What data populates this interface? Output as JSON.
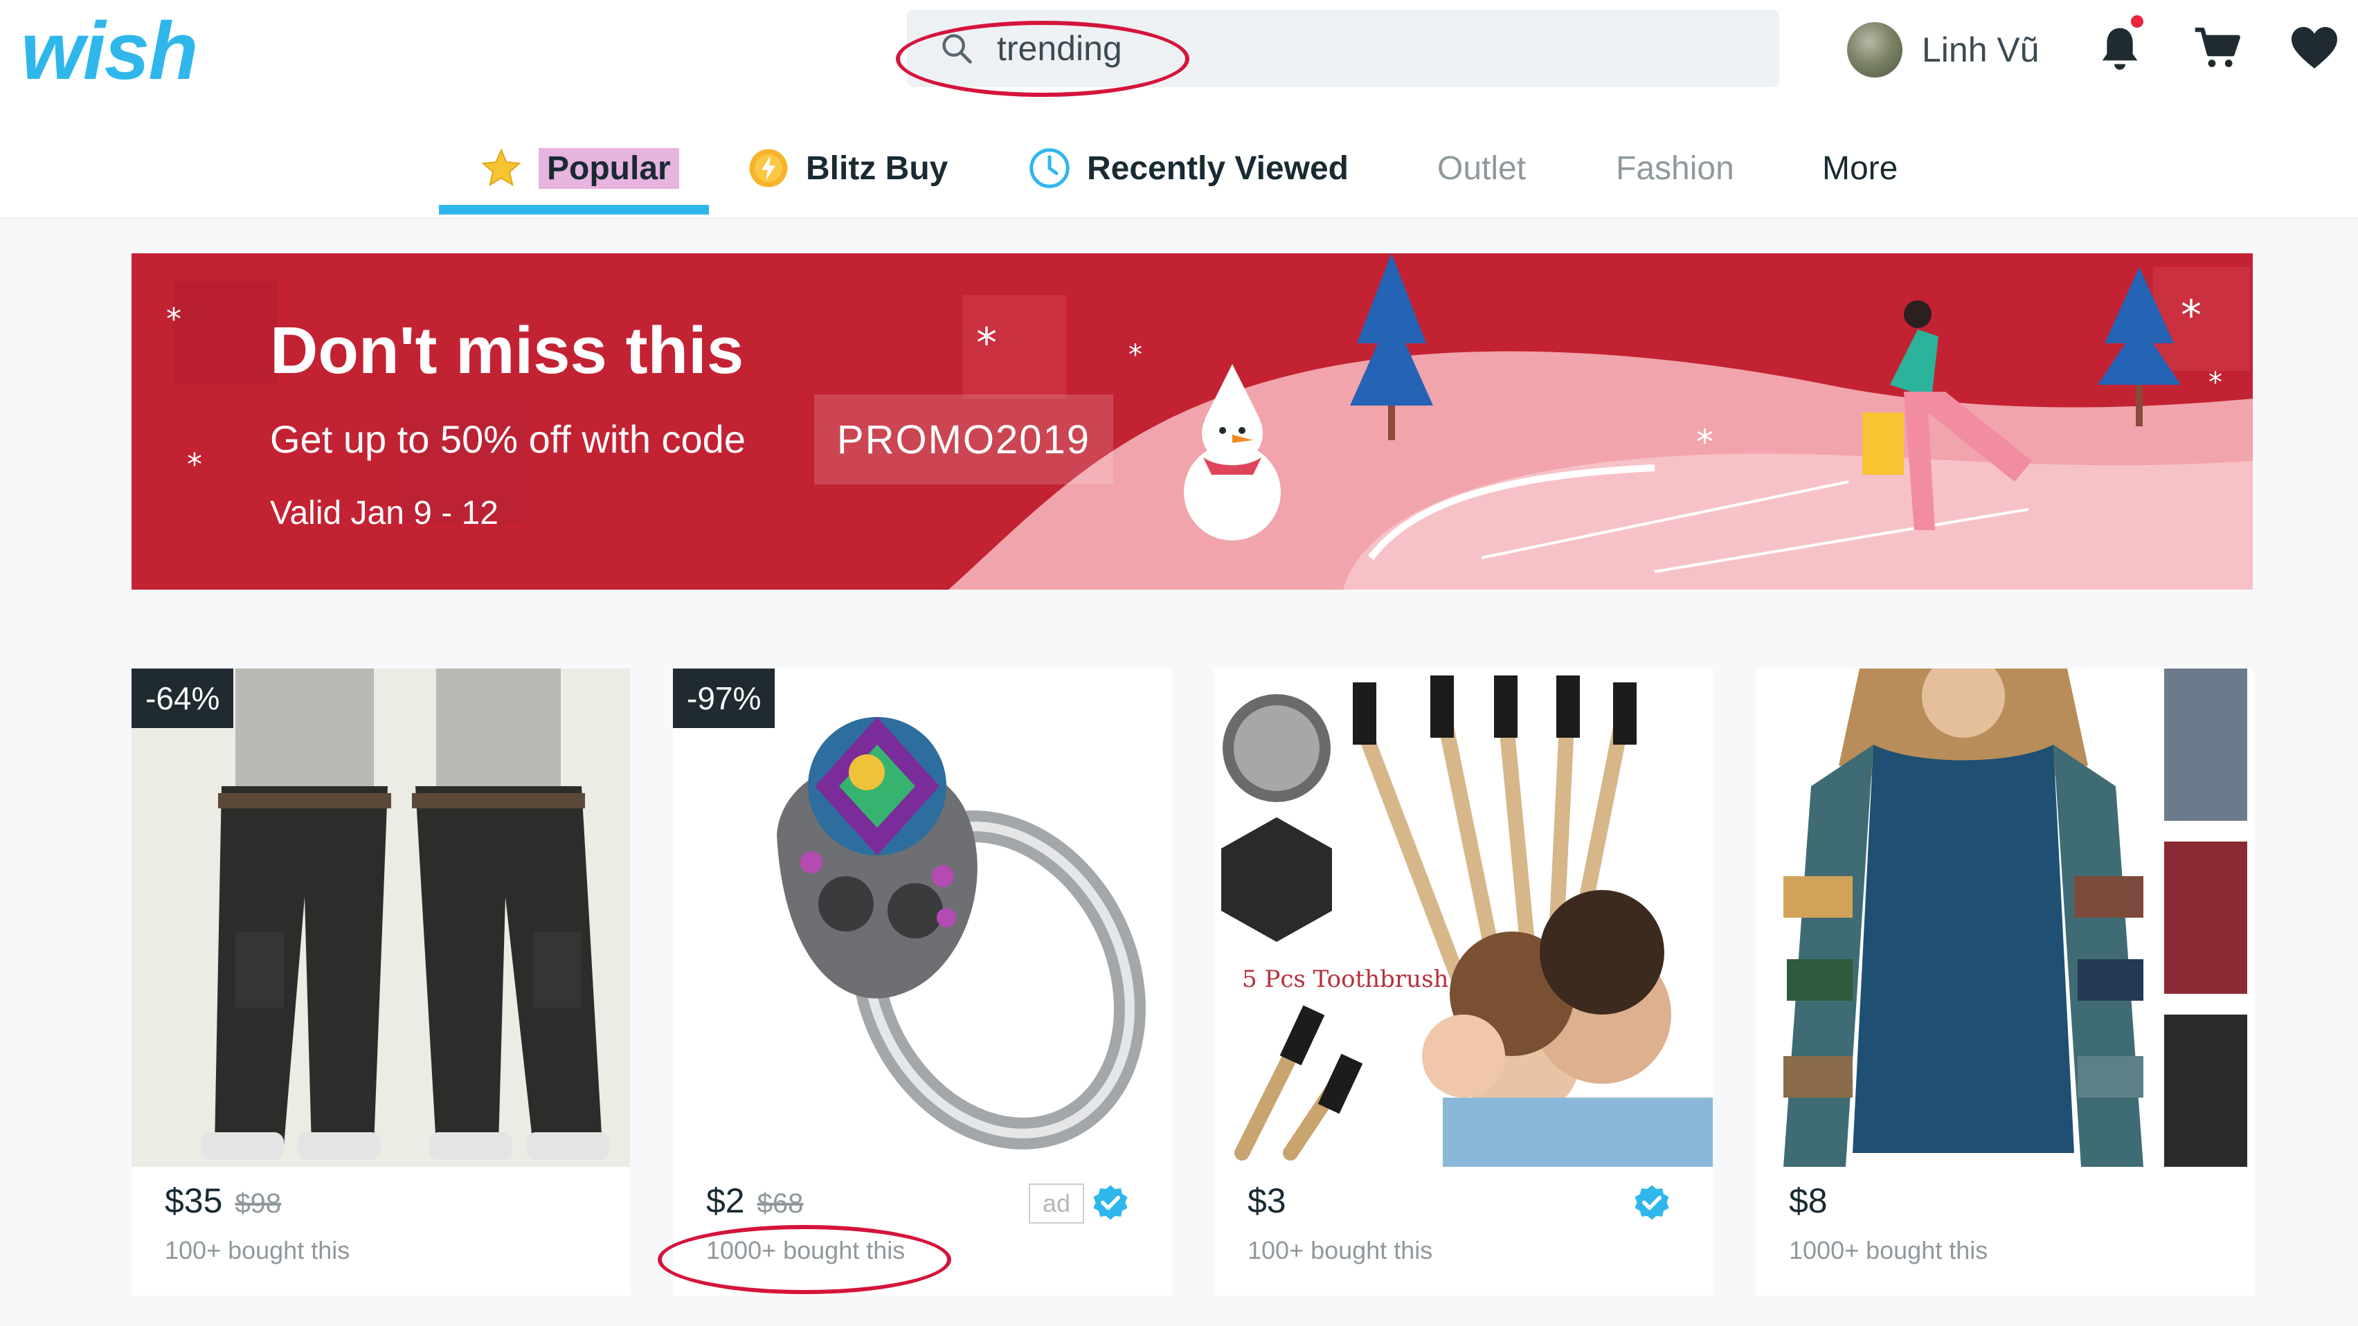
{
  "header": {
    "logo_text": "wish",
    "search": {
      "value": "trending",
      "placeholder": ""
    },
    "user": {
      "name": "Linh Vũ"
    },
    "icons": [
      "search-icon",
      "bell-icon",
      "cart-icon",
      "heart-icon"
    ]
  },
  "tabs": [
    {
      "label": "Popular",
      "icon": "star-icon",
      "active": true
    },
    {
      "label": "Blitz Buy",
      "icon": "blitz-coin-icon"
    },
    {
      "label": "Recently Viewed",
      "icon": "clock-icon"
    },
    {
      "label": "Outlet"
    },
    {
      "label": "Fashion"
    },
    {
      "label": "More"
    }
  ],
  "banner": {
    "title": "Don't miss this",
    "subtitle": "Get up to 50% off with code",
    "code": "PROMO2019",
    "valid": "Valid Jan 9 - 12"
  },
  "products": [
    {
      "badge": "-64%",
      "price": "$35",
      "old_price": "$98",
      "bought": "100+ bought this",
      "image": "cargo pants"
    },
    {
      "badge": "-97%",
      "price": "$2",
      "old_price": "$68",
      "bought": "1000+ bought this",
      "ad": "ad",
      "verified": true,
      "image": "skull ring"
    },
    {
      "price": "$3",
      "bought": "100+ bought this",
      "verified": true,
      "image_text": "5 Pcs Toothbrush",
      "image": "bamboo toothbrush"
    },
    {
      "price": "$8",
      "bought": "1000+ bought this",
      "image": "striped sleeve top"
    }
  ],
  "colors": {
    "brand": "#2fb7ec",
    "banner_red": "#c32233",
    "annotation_red": "#d5143b",
    "active_tab_highlight": "#e7b3df",
    "verified_blue": "#2fb7ec"
  }
}
